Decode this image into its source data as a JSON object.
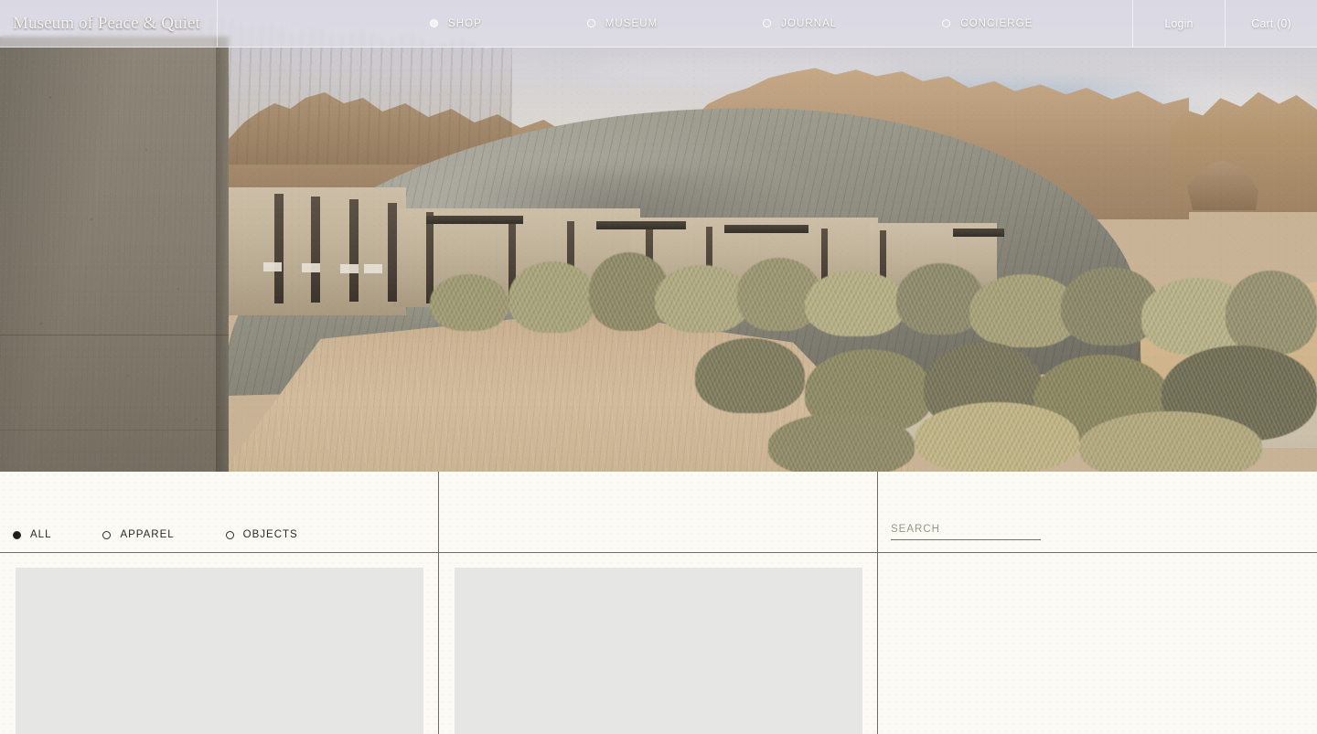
{
  "header": {
    "brand": "Museum of Peace & Quiet",
    "nav": [
      {
        "label": "SHOP",
        "indicator": "filled-dot-icon",
        "active": true
      },
      {
        "label": "MUSEUM",
        "indicator": "hollow-dot-icon",
        "active": false
      },
      {
        "label": "JOURNAL",
        "indicator": "hollow-dot-icon",
        "active": false
      },
      {
        "label": "CONCIERGE",
        "indicator": "hollow-dot-icon",
        "active": false
      }
    ],
    "login_label": "Login",
    "cart_label": "Cart (0)",
    "cart_count": 0
  },
  "hero": {
    "alt": "Desert landscape with low concrete pavilion buildings beneath a sandstone mesa",
    "scene": "desert-architecture-photo"
  },
  "toolbar": {
    "filters": [
      {
        "label": "ALL",
        "indicator": "filled-dot-icon",
        "active": true
      },
      {
        "label": "APPAREL",
        "indicator": "hollow-dot-icon",
        "active": false
      },
      {
        "label": "OBJECTS",
        "indicator": "hollow-dot-icon",
        "active": false
      }
    ],
    "search": {
      "value": "",
      "placeholder": "SEARCH"
    }
  },
  "product_grid": {
    "items": [
      {
        "state": "loading-placeholder"
      },
      {
        "state": "loading-placeholder"
      }
    ],
    "empty_column": true
  },
  "colors": {
    "page_background": "#fbfaf5",
    "rule": "#6d6c5d",
    "text": "#2b2b26",
    "header_overlay": "#e7e6ee",
    "header_text": "#fafafa",
    "skeleton": "#e6e6e4",
    "search_underline": "#74736a",
    "placeholder_text": "#9a978b"
  }
}
